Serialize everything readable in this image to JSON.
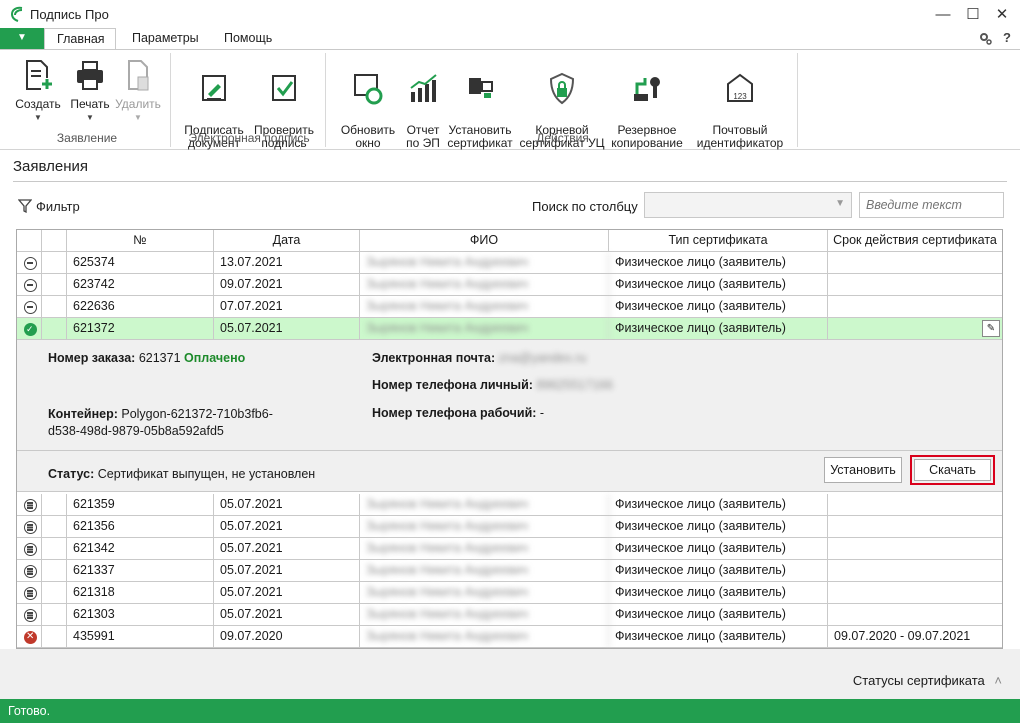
{
  "window": {
    "title": "Подпись Про",
    "minimize": "—",
    "maximize": "☐",
    "close": "✕"
  },
  "tabs": [
    "Главная",
    "Параметры",
    "Помощь"
  ],
  "ribbon": {
    "create": "Создать",
    "print": "Печать",
    "delete": "Удалить",
    "group_app": "Заявление",
    "sign_doc": "Подписать\nдокумент",
    "check_sign": "Проверить\nподпись",
    "group_sign": "Электронная подпись",
    "refresh": "Обновить\nокно",
    "report": "Отчет\nпо ЭП",
    "install_cert": "Установить\nсертификат",
    "root_cert": "Корневой\nсертификат УЦ",
    "backup": "Резервное\nкопирование",
    "mail_id": "Почтовый\nидентификатор",
    "group_actions": "Действия"
  },
  "main": {
    "title": "Заявления",
    "filter": "Фильтр",
    "search_label": "Поиск по столбцу",
    "search_placeholder": "Введите текст"
  },
  "grid": {
    "headers": [
      "№",
      "Дата",
      "ФИО",
      "Тип сертификата",
      "Срок действия сертификата"
    ],
    "rows_top": [
      {
        "num": "625374",
        "date": "13.07.2021",
        "fio": "Зырянов Никита Андреевич",
        "type": "Физическое лицо (заявитель)",
        "term": ""
      },
      {
        "num": "623742",
        "date": "09.07.2021",
        "fio": "Зырянов Никита Андреевич",
        "type": "Физическое лицо (заявитель)",
        "term": ""
      },
      {
        "num": "622636",
        "date": "07.07.2021",
        "fio": "Зырянов Никита Андреевич",
        "type": "Физическое лицо (заявитель)",
        "term": ""
      },
      {
        "num": "621372",
        "date": "05.07.2021",
        "fio": "Зырянов Никита Андреевич",
        "type": "Физическое лицо (заявитель)",
        "term": ""
      }
    ],
    "rows_bottom": [
      {
        "num": "621359",
        "date": "05.07.2021",
        "fio": "Зырянов Никита Андреевич",
        "type": "Физическое лицо (заявитель)",
        "term": ""
      },
      {
        "num": "621356",
        "date": "05.07.2021",
        "fio": "Зырянов Никита Андреевич",
        "type": "Физическое лицо (заявитель)",
        "term": ""
      },
      {
        "num": "621342",
        "date": "05.07.2021",
        "fio": "Зырянов Никита Андреевич",
        "type": "Физическое лицо (заявитель)",
        "term": ""
      },
      {
        "num": "621337",
        "date": "05.07.2021",
        "fio": "Зырянов Никита Андреевич",
        "type": "Физическое лицо (заявитель)",
        "term": ""
      },
      {
        "num": "621318",
        "date": "05.07.2021",
        "fio": "Зырянов Никита Андреевич",
        "type": "Физическое лицо (заявитель)",
        "term": ""
      },
      {
        "num": "621303",
        "date": "05.07.2021",
        "fio": "Зырянов Никита Андреевич",
        "type": "Физическое лицо (заявитель)",
        "term": ""
      },
      {
        "num": "435991",
        "date": "09.07.2020",
        "fio": "Зырянов Никита Андреевич",
        "type": "Физическое лицо (заявитель)",
        "term": "09.07.2020 - 09.07.2021"
      }
    ]
  },
  "detail": {
    "order_label": "Номер заказа:",
    "order_num": "621371",
    "order_status": "Оплачено",
    "container_label": "Контейнер:",
    "container_value": "Polygon-621372-710b3fb6-\nd538-498d-9879-05b8a592afd5",
    "email_label": "Электронная почта:",
    "email_value": "zna@yandex.ru",
    "phone_personal_label": "Номер телефона личный:",
    "phone_personal_value": "89625517166",
    "phone_work_label": "Номер телефона рабочий:",
    "phone_work_value": "-",
    "status_label": "Статус:",
    "status_value": "Сертификат выпущен, не установлен",
    "install_button": "Установить",
    "download_button": "Скачать"
  },
  "footer": {
    "cert_statuses": "Статусы сертификата"
  },
  "statusbar": {
    "text": "Готово."
  },
  "colors": {
    "accent": "#229e4f",
    "selected_row": "#ccf8cc",
    "paid": "#1c8a2a",
    "highlight": "#d9001b"
  }
}
